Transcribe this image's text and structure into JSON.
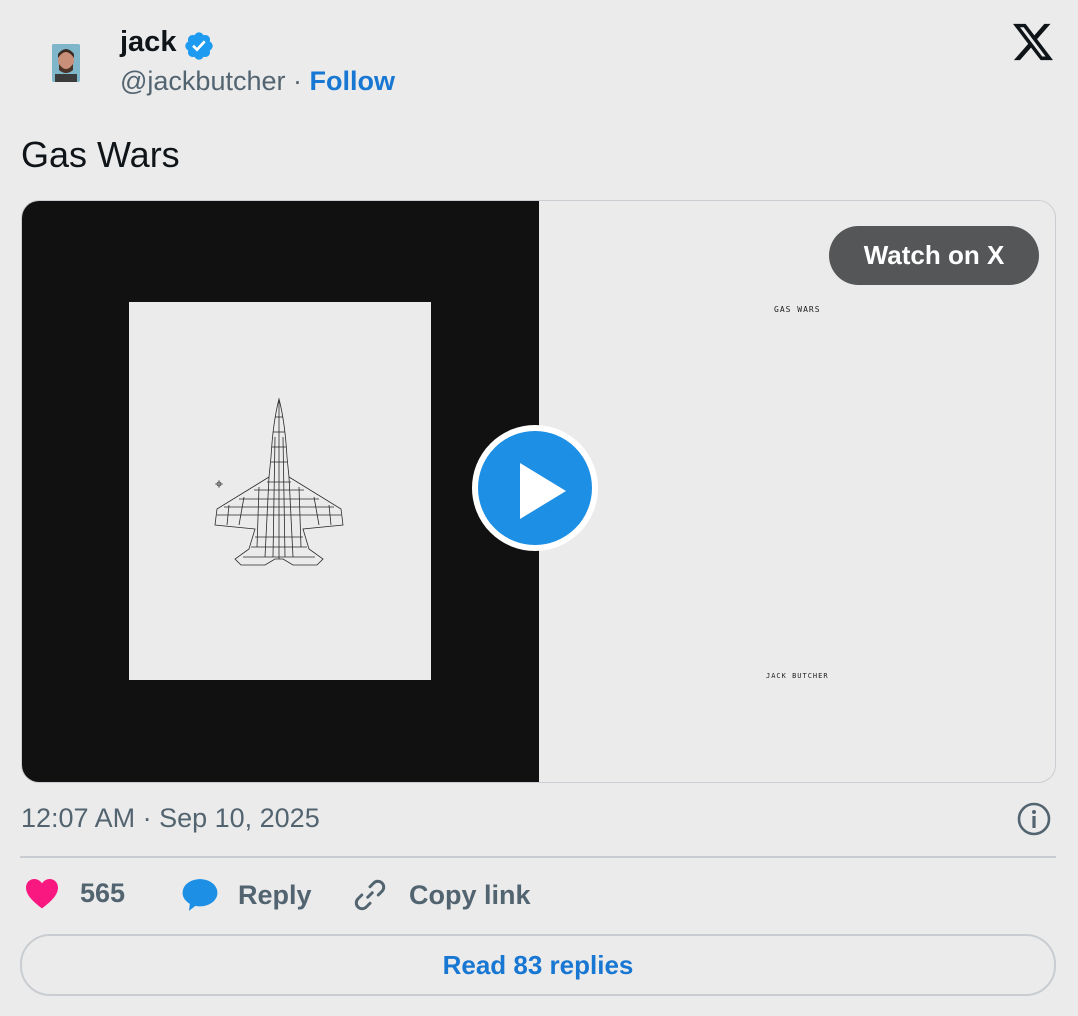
{
  "author": {
    "name": "jack",
    "handle": "@jackbutcher",
    "separator": "·",
    "follow_label": "Follow",
    "verified_color": "#1d9bf0"
  },
  "tweet": {
    "text": "Gas Wars"
  },
  "media": {
    "poster_title": "GAS WARS",
    "poster_author": "JACK BUTCHER",
    "watch_label": "Watch on X",
    "play_icon": "play-icon"
  },
  "meta": {
    "timestamp": "12:07 AM · Sep 10, 2025",
    "info_icon": "info-icon"
  },
  "actions": {
    "like_count": "565",
    "reply_label": "Reply",
    "copy_label": "Copy link"
  },
  "read_replies_label": "Read 83 replies",
  "colors": {
    "link_blue": "#1877d2",
    "heart": "#f91880",
    "play_blue": "#1d8fe5"
  }
}
